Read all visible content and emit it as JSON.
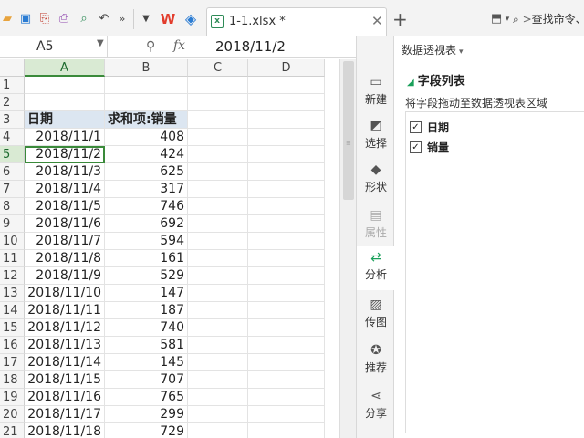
{
  "toolbar": {
    "file_tab": "1-1.xlsx *",
    "search_label": "查找命令、",
    "colors": {
      "wps_red": "#e23c2c",
      "green": "#2e8b57",
      "blue": "#2b7cd3"
    }
  },
  "formula_bar": {
    "name_box": "A5",
    "fx": "fx",
    "value": "2018/11/2"
  },
  "grid": {
    "columns": [
      "A",
      "B",
      "C",
      "D"
    ],
    "active_column": "A",
    "active_row": "5",
    "header_row": {
      "row": "3",
      "a": "日期",
      "b": "求和项:销量"
    },
    "rows": [
      {
        "n": "1",
        "a": "",
        "b": ""
      },
      {
        "n": "2",
        "a": "",
        "b": ""
      },
      {
        "n": "4",
        "a": "2018/11/1",
        "b": "408"
      },
      {
        "n": "5",
        "a": "2018/11/2",
        "b": "424"
      },
      {
        "n": "6",
        "a": "2018/11/3",
        "b": "625"
      },
      {
        "n": "7",
        "a": "2018/11/4",
        "b": "317"
      },
      {
        "n": "8",
        "a": "2018/11/5",
        "b": "746"
      },
      {
        "n": "9",
        "a": "2018/11/6",
        "b": "692"
      },
      {
        "n": "10",
        "a": "2018/11/7",
        "b": "594"
      },
      {
        "n": "11",
        "a": "2018/11/8",
        "b": "161"
      },
      {
        "n": "12",
        "a": "2018/11/9",
        "b": "529"
      },
      {
        "n": "13",
        "a": "2018/11/10",
        "b": "147"
      },
      {
        "n": "14",
        "a": "2018/11/11",
        "b": "187"
      },
      {
        "n": "15",
        "a": "2018/11/12",
        "b": "740"
      },
      {
        "n": "16",
        "a": "2018/11/13",
        "b": "581"
      },
      {
        "n": "17",
        "a": "2018/11/14",
        "b": "145"
      },
      {
        "n": "18",
        "a": "2018/11/15",
        "b": "707"
      },
      {
        "n": "19",
        "a": "2018/11/16",
        "b": "765"
      },
      {
        "n": "20",
        "a": "2018/11/17",
        "b": "299"
      },
      {
        "n": "21",
        "a": "2018/11/18",
        "b": "729"
      }
    ]
  },
  "side_tools": [
    {
      "label": "新建",
      "icon": "new-icon"
    },
    {
      "label": "选择",
      "icon": "select-icon"
    },
    {
      "label": "形状",
      "icon": "shape-icon"
    },
    {
      "label": "属性",
      "icon": "property-icon"
    },
    {
      "label": "分析",
      "icon": "analysis-icon"
    },
    {
      "label": "传图",
      "icon": "upload-image-icon"
    },
    {
      "label": "推荐",
      "icon": "recommend-icon"
    },
    {
      "label": "分享",
      "icon": "share-icon"
    }
  ],
  "pivot_panel": {
    "title": "数据透视表",
    "section": "字段列表",
    "hint": "将字段拖动至数据透视表区域",
    "fields": [
      {
        "label": "日期",
        "checked": true
      },
      {
        "label": "销量",
        "checked": true
      }
    ]
  }
}
